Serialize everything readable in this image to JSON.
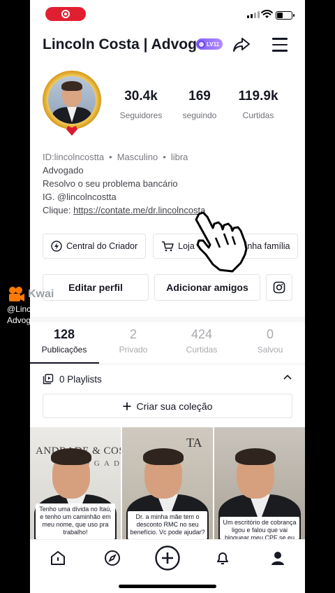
{
  "header": {
    "title": "Lincoln Costa | Advogado",
    "level_badge": "LV11"
  },
  "profile": {
    "stats": [
      {
        "value": "30.4k",
        "label": "Seguidores"
      },
      {
        "value": "169",
        "label": "seguindo"
      },
      {
        "value": "119.9k",
        "label": "Curtidas"
      }
    ],
    "meta": {
      "id": "ID:lincolncostta",
      "gender": "Masculino",
      "sign": "libra"
    },
    "bio_lines": [
      "Advogado",
      "Resolvo o seu problema bancário",
      "IG. @lincolncostta"
    ],
    "link_prefix": "Clique: ",
    "link": "https://contate.me/dr.lincolncosta"
  },
  "chips": [
    {
      "label": "Central do Criador",
      "icon": "lightning-icon"
    },
    {
      "label": "Loja",
      "icon": "cart-icon"
    },
    {
      "label": "Minha família",
      "icon": "family-icon"
    }
  ],
  "actions": {
    "edit": "Editar perfil",
    "add_friends": "Adicionar amigos"
  },
  "tabs": [
    {
      "count": "128",
      "label": "Publicações",
      "active": true
    },
    {
      "count": "2",
      "label": "Privado",
      "active": false
    },
    {
      "count": "424",
      "label": "Curtidas",
      "active": false
    },
    {
      "count": "0",
      "label": "Salvou",
      "active": false
    }
  ],
  "playlists": {
    "label": "0 Playlists",
    "create": "Criar sua coleção"
  },
  "videos": [
    {
      "brand": "ANDRADE & COS",
      "brand_sub": "A D V O G A D O S",
      "caption": "Tenho uma dívida no Itaú, e tenho um caminhão em meu nome, que uso pra trabalho!"
    },
    {
      "wallmark": "TA",
      "caption": "Dr. a minha mãe tem o desconto RMC no seu benefício. Vc pode ajudar?"
    },
    {
      "caption": "Um escritório de cobrança ligou e falou que vai bloquear meu CPF se eu não pagar uma dívida de"
    }
  ],
  "watermark": {
    "app": "Kwai",
    "handle": "@Lincoln",
    "subtitle": "Advogado"
  },
  "colors": {
    "record": "#e02030",
    "badge": "#7c5cff",
    "text": "#161823",
    "secondary": "#6f7077"
  }
}
